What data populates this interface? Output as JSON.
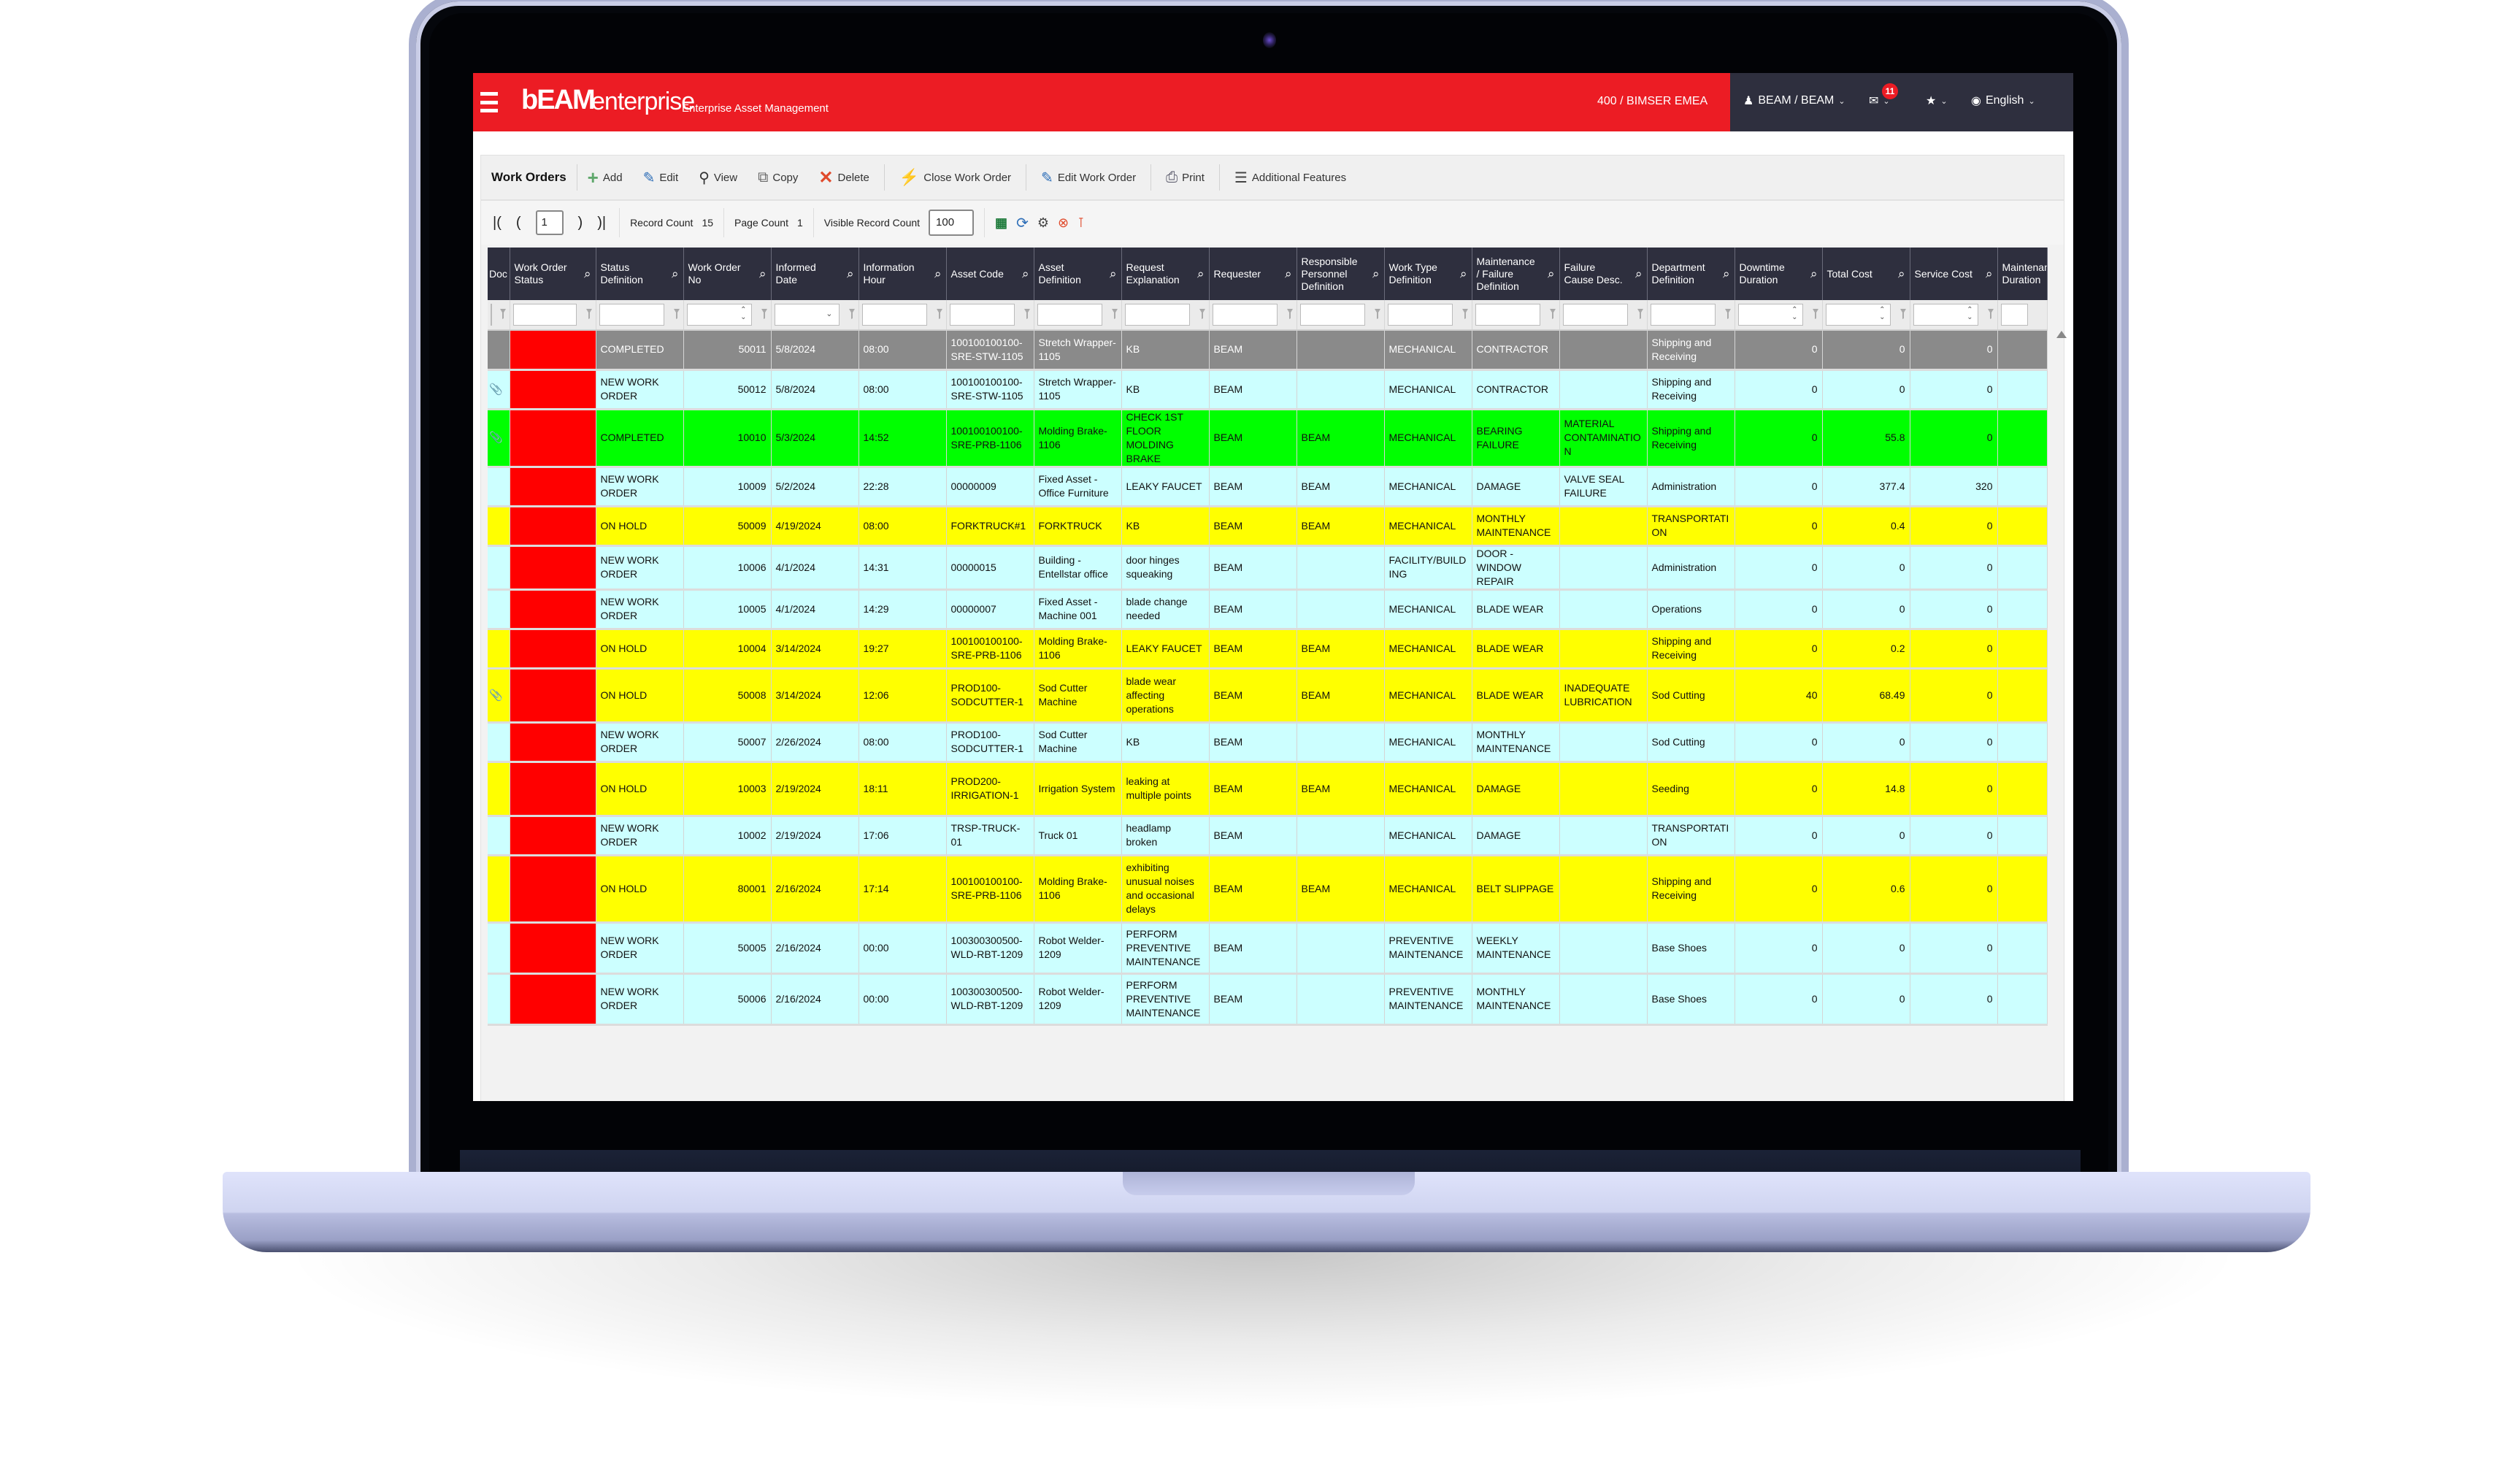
{
  "app": {
    "logo_primary": "bEAM",
    "logo_secondary": "enterprise",
    "subtitle": "Enterprise Asset Management",
    "tenant": "400 / BIMSER EMEA",
    "user": "BEAM / BEAM",
    "notification_count": "11",
    "language": "English",
    "brand_color": "#ec1c24",
    "dark_color": "#2e2f3e"
  },
  "toolbar": {
    "title": "Work Orders",
    "buttons": [
      {
        "label": "Add",
        "icon": "plus-icon"
      },
      {
        "label": "Edit",
        "icon": "pencil-icon"
      },
      {
        "label": "View",
        "icon": "magnifier-icon"
      },
      {
        "label": "Copy",
        "icon": "copy-icon"
      },
      {
        "label": "Delete",
        "icon": "x-icon"
      },
      {
        "label": "Close Work Order",
        "icon": "lightning-icon"
      },
      {
        "label": "Edit Work Order",
        "icon": "pencil-icon"
      },
      {
        "label": "Print",
        "icon": "printer-icon"
      },
      {
        "label": "Additional Features",
        "icon": "menu-icon"
      }
    ]
  },
  "pager": {
    "first": "|(",
    "prev": "(",
    "page": "1",
    "next": ")",
    "last": ")|",
    "record_count_label": "Record Count",
    "record_count": "15",
    "page_count_label": "Page Count",
    "page_count": "1",
    "visible_record_label": "Visible Record Count",
    "visible_record_count": "100"
  },
  "grid": {
    "columns": [
      "Doc",
      "Work Order Status",
      "Status Definition",
      "Work Order No",
      "Informed Date",
      "Information Hour",
      "Asset Code",
      "Asset Definition",
      "Request Explanation",
      "Requester",
      "Responsible Personnel Definition",
      "Work Type Definition",
      "Maintenance / Failure Definition",
      "Failure Cause Desc.",
      "Department Definition",
      "Downtime Duration",
      "Total Cost",
      "Service Cost",
      "Maintenance Duration"
    ],
    "rows": [
      {
        "color": "gray",
        "doc": "",
        "status": "COMPLETED",
        "no": "50011",
        "date": "5/8/2024",
        "hour": "08:00",
        "asset_code": "100100100100-SRE-STW-1105",
        "asset_def": "Stretch Wrapper-1105",
        "req_expl": "KB",
        "requester": "BEAM",
        "resp": "",
        "work_type": "MECHANICAL",
        "maint": "CONTRACTOR",
        "cause": "",
        "dept": "Shipping and Receiving",
        "downtime": "0",
        "total": "0",
        "service": "0",
        "mdur": ""
      },
      {
        "color": "cyan",
        "doc": "attachment",
        "status": "NEW WORK ORDER",
        "no": "50012",
        "date": "5/8/2024",
        "hour": "08:00",
        "asset_code": "100100100100-SRE-STW-1105",
        "asset_def": "Stretch Wrapper-1105",
        "req_expl": "KB",
        "requester": "BEAM",
        "resp": "",
        "work_type": "MECHANICAL",
        "maint": "CONTRACTOR",
        "cause": "",
        "dept": "Shipping and Receiving",
        "downtime": "0",
        "total": "0",
        "service": "0",
        "mdur": ""
      },
      {
        "color": "green",
        "doc": "attachment",
        "status": "COMPLETED",
        "no": "10010",
        "date": "5/3/2024",
        "hour": "14:52",
        "asset_code": "100100100100-SRE-PRB-1106",
        "asset_def": "Molding Brake-1106",
        "req_expl": "CHECK 1ST FLOOR MOLDING BRAKE",
        "requester": "BEAM",
        "resp": "BEAM",
        "work_type": "MECHANICAL",
        "maint": "BEARING FAILURE",
        "cause": "MATERIAL CONTAMINATION",
        "dept": "Shipping and Receiving",
        "downtime": "0",
        "total": "55.8",
        "service": "0",
        "mdur": ""
      },
      {
        "color": "cyan",
        "doc": "",
        "status": "NEW WORK ORDER",
        "no": "10009",
        "date": "5/2/2024",
        "hour": "22:28",
        "asset_code": "00000009",
        "asset_def": "Fixed Asset - Office Furniture",
        "req_expl": "LEAKY FAUCET",
        "requester": "BEAM",
        "resp": "BEAM",
        "work_type": "MECHANICAL",
        "maint": "DAMAGE",
        "cause": "VALVE SEAL FAILURE",
        "dept": "Administration",
        "downtime": "0",
        "total": "377.4",
        "service": "320",
        "mdur": ""
      },
      {
        "color": "yellow",
        "doc": "",
        "status": "ON HOLD",
        "no": "50009",
        "date": "4/19/2024",
        "hour": "08:00",
        "asset_code": "FORKTRUCK#1",
        "asset_def": "FORKTRUCK",
        "req_expl": "KB",
        "requester": "BEAM",
        "resp": "BEAM",
        "work_type": "MECHANICAL",
        "maint": "MONTHLY MAINTENANCE",
        "cause": "",
        "dept": "TRANSPORTATION",
        "downtime": "0",
        "total": "0.4",
        "service": "0",
        "mdur": ""
      },
      {
        "color": "cyan",
        "doc": "",
        "status": "NEW WORK ORDER",
        "no": "10006",
        "date": "4/1/2024",
        "hour": "14:31",
        "asset_code": "00000015",
        "asset_def": "Building - Entellstar office",
        "req_expl": "door hinges squeaking",
        "requester": "BEAM",
        "resp": "",
        "work_type": "FACILITY/BUILDING",
        "maint": "DOOR - WINDOW REPAIR",
        "cause": "",
        "dept": "Administration",
        "downtime": "0",
        "total": "0",
        "service": "0",
        "mdur": ""
      },
      {
        "color": "cyan",
        "doc": "",
        "status": "NEW WORK ORDER",
        "no": "10005",
        "date": "4/1/2024",
        "hour": "14:29",
        "asset_code": "00000007",
        "asset_def": "Fixed Asset - Machine 001",
        "req_expl": "blade change needed",
        "requester": "BEAM",
        "resp": "",
        "work_type": "MECHANICAL",
        "maint": "BLADE WEAR",
        "cause": "",
        "dept": "Operations",
        "downtime": "0",
        "total": "0",
        "service": "0",
        "mdur": ""
      },
      {
        "color": "yellow",
        "doc": "",
        "status": "ON HOLD",
        "no": "10004",
        "date": "3/14/2024",
        "hour": "19:27",
        "asset_code": "100100100100-SRE-PRB-1106",
        "asset_def": "Molding Brake-1106",
        "req_expl": "LEAKY FAUCET",
        "requester": "BEAM",
        "resp": "BEAM",
        "work_type": "MECHANICAL",
        "maint": "BLADE WEAR",
        "cause": "",
        "dept": "Shipping and Receiving",
        "downtime": "0",
        "total": "0.2",
        "service": "0",
        "mdur": ""
      },
      {
        "color": "yellow",
        "doc": "attachment",
        "status": "ON HOLD",
        "no": "50008",
        "date": "3/14/2024",
        "hour": "12:06",
        "asset_code": "PROD100-SODCUTTER-1",
        "asset_def": "Sod Cutter Machine",
        "req_expl": "blade wear affecting operations",
        "requester": "BEAM",
        "resp": "BEAM",
        "work_type": "MECHANICAL",
        "maint": "BLADE WEAR",
        "cause": "INADEQUATE LUBRICATION",
        "dept": "Sod Cutting",
        "downtime": "40",
        "total": "68.49",
        "service": "0",
        "mdur": ""
      },
      {
        "color": "cyan",
        "doc": "",
        "status": "NEW WORK ORDER",
        "no": "50007",
        "date": "2/26/2024",
        "hour": "08:00",
        "asset_code": "PROD100-SODCUTTER-1",
        "asset_def": "Sod Cutter Machine",
        "req_expl": "KB",
        "requester": "BEAM",
        "resp": "",
        "work_type": "MECHANICAL",
        "maint": "MONTHLY MAINTENANCE",
        "cause": "",
        "dept": "Sod Cutting",
        "downtime": "0",
        "total": "0",
        "service": "0",
        "mdur": ""
      },
      {
        "color": "yellow",
        "doc": "",
        "status": "ON HOLD",
        "no": "10003",
        "date": "2/19/2024",
        "hour": "18:11",
        "asset_code": "PROD200-IRRIGATION-1",
        "asset_def": "Irrigation System",
        "req_expl": "leaking at multiple points",
        "requester": "BEAM",
        "resp": "BEAM",
        "work_type": "MECHANICAL",
        "maint": "DAMAGE",
        "cause": "",
        "dept": "Seeding",
        "downtime": "0",
        "total": "14.8",
        "service": "0",
        "mdur": ""
      },
      {
        "color": "cyan",
        "doc": "",
        "status": "NEW WORK ORDER",
        "no": "10002",
        "date": "2/19/2024",
        "hour": "17:06",
        "asset_code": "TRSP-TRUCK-01",
        "asset_def": "Truck 01",
        "req_expl": "headlamp broken",
        "requester": "BEAM",
        "resp": "",
        "work_type": "MECHANICAL",
        "maint": "DAMAGE",
        "cause": "",
        "dept": "TRANSPORTATION",
        "downtime": "0",
        "total": "0",
        "service": "0",
        "mdur": ""
      },
      {
        "color": "yellow",
        "doc": "",
        "status": "ON HOLD",
        "no": "80001",
        "date": "2/16/2024",
        "hour": "17:14",
        "asset_code": "100100100100-SRE-PRB-1106",
        "asset_def": "Molding Brake-1106",
        "req_expl": "exhibiting unusual noises and occasional delays",
        "requester": "BEAM",
        "resp": "BEAM",
        "work_type": "MECHANICAL",
        "maint": "BELT SLIPPAGE",
        "cause": "",
        "dept": "Shipping and Receiving",
        "downtime": "0",
        "total": "0.6",
        "service": "0",
        "mdur": ""
      },
      {
        "color": "cyan",
        "doc": "",
        "status": "NEW WORK ORDER",
        "no": "50005",
        "date": "2/16/2024",
        "hour": "00:00",
        "asset_code": "100300300500-WLD-RBT-1209",
        "asset_def": "Robot Welder-1209",
        "req_expl": "PERFORM PREVENTIVE MAINTENANCE",
        "requester": "BEAM",
        "resp": "",
        "work_type": "PREVENTIVE MAINTENANCE",
        "maint": "WEEKLY MAINTENANCE",
        "cause": "",
        "dept": "Base Shoes",
        "downtime": "0",
        "total": "0",
        "service": "0",
        "mdur": ""
      },
      {
        "color": "cyan",
        "doc": "",
        "status": "NEW WORK ORDER",
        "no": "50006",
        "date": "2/16/2024",
        "hour": "00:00",
        "asset_code": "100300300500-WLD-RBT-1209",
        "asset_def": "Robot Welder-1209",
        "req_expl": "PERFORM PREVENTIVE MAINTENANCE",
        "requester": "BEAM",
        "resp": "",
        "work_type": "PREVENTIVE MAINTENANCE",
        "maint": "MONTHLY MAINTENANCE",
        "cause": "",
        "dept": "Base Shoes",
        "downtime": "0",
        "total": "0",
        "service": "0",
        "mdur": ""
      }
    ]
  }
}
